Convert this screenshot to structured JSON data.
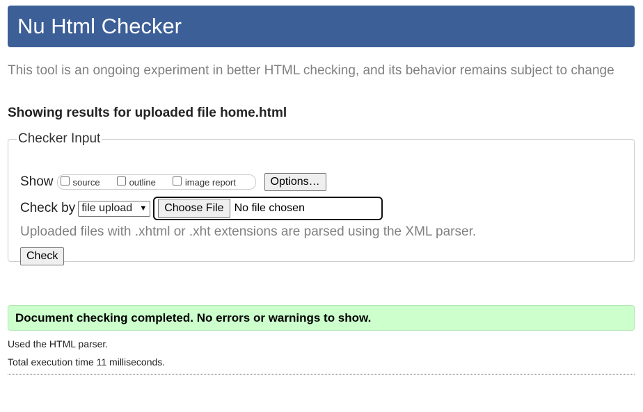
{
  "header": {
    "title": "Nu Html Checker"
  },
  "intro": "This tool is an ongoing experiment in better HTML checking, and its behavior remains subject to change",
  "results_heading": "Showing results for uploaded file home.html",
  "checker": {
    "legend": "Checker Input",
    "show_label": "Show",
    "show_options": [
      {
        "label": "source",
        "checked": false
      },
      {
        "label": "outline",
        "checked": false
      },
      {
        "label": "image report",
        "checked": false
      }
    ],
    "options_button": "Options…",
    "check_by_label": "Check by",
    "check_by_selected": "file upload",
    "choose_file_button": "Choose File",
    "file_status": "No file chosen",
    "note": "Uploaded files with .xhtml or .xht extensions are parsed using the XML parser.",
    "check_button": "Check"
  },
  "result": {
    "message": "Document checking completed. No errors or warnings to show.",
    "color": "#ccffcc"
  },
  "meta": {
    "parser": "Used the HTML parser.",
    "time": "Total execution time 11 milliseconds."
  },
  "colors": {
    "header_bg": "#3d5f98"
  }
}
